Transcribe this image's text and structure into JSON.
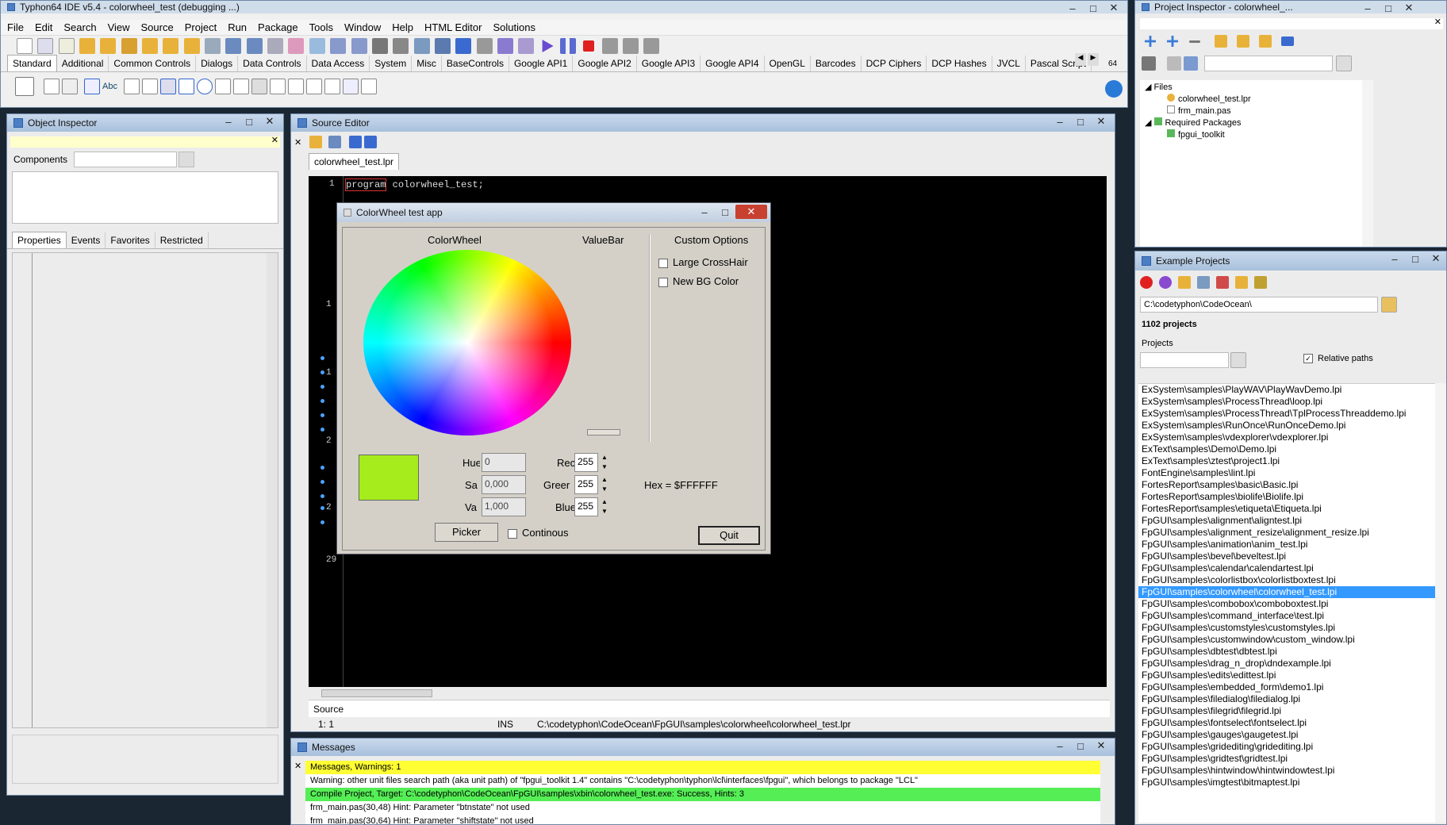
{
  "ide": {
    "title": "Typhon64 IDE v5.4 - colorwheel_test (debugging ...)",
    "menu": [
      "File",
      "Edit",
      "Search",
      "View",
      "Source",
      "Project",
      "Run",
      "Package",
      "Tools",
      "Window",
      "Help",
      "HTML Editor",
      "Solutions"
    ],
    "palette_tabs": [
      "Standard",
      "Additional",
      "Common Controls",
      "Dialogs",
      "Data Controls",
      "Data Access",
      "System",
      "Misc",
      "BaseControls",
      "Google API1",
      "Google API2",
      "Google API3",
      "Google API4",
      "OpenGL",
      "Barcodes",
      "DCP Ciphers",
      "DCP Hashes",
      "JVCL",
      "Pascal Script"
    ],
    "bits": "64"
  },
  "object_inspector": {
    "title": "Object Inspector",
    "components_label": "Components",
    "tabs": [
      "Properties",
      "Events",
      "Favorites",
      "Restricted"
    ]
  },
  "source_editor": {
    "title": "Source Editor",
    "file_tab": "colorwheel_test.lpr",
    "code_keyword": "program",
    "code_rest": " colorwheel_test;",
    "line_numbers": [
      "1",
      "1",
      "1",
      "2",
      "2",
      "29"
    ],
    "bottom_tab": "Source",
    "status_pos": "1:  1",
    "status_mode": "INS",
    "status_path": "C:\\codetyphon\\CodeOcean\\FpGUI\\samples\\colorwheel\\colorwheel_test.lpr"
  },
  "app": {
    "title": "ColorWheel test app",
    "colorwheel_label": "ColorWheel",
    "valuebar_label": "ValueBar",
    "custom_options_label": "Custom Options",
    "large_crosshair": "Large CrossHair",
    "new_bg_color": "New BG Color",
    "swatch_color": "#a6ec1c",
    "hue_label": "Hue",
    "hue_value": "0",
    "sat_label": "Sa",
    "sat_value": "0,000",
    "val_label": "Va",
    "val_value": "1,000",
    "red_label": "Rec",
    "red_value": "255",
    "green_label": "Greer",
    "green_value": "255",
    "blue_label": "Blue",
    "blue_value": "255",
    "hex": "Hex = $FFFFFF",
    "picker": "Picker",
    "continous": "Continous",
    "quit": "Quit"
  },
  "messages": {
    "title": "Messages",
    "rows": [
      {
        "text": "Messages, Warnings: 1",
        "color": "#ffff33"
      },
      {
        "text": "Warning: other unit files search path (aka unit path) of \"fpgui_toolkit 1.4\" contains \"C:\\codetyphon\\typhon\\lcl\\interfaces\\fpgui\", which belongs to package \"LCL\"",
        "color": "#ffffff"
      },
      {
        "text": "Compile Project, Target: C:\\codetyphon\\CodeOcean\\FpGUI\\samples\\xbin\\colorwheel_test.exe: Success, Hints: 3",
        "color": "#55ee55"
      },
      {
        "text": "frm_main.pas(30,48) Hint: Parameter \"btnstate\" not used",
        "color": "#ffffff"
      },
      {
        "text": "frm_main.pas(30,64) Hint: Parameter \"shiftstate\" not used",
        "color": "#ffffff"
      }
    ]
  },
  "project_inspector": {
    "title": "Project Inspector - colorwheel_...",
    "files_label": "Files",
    "files": [
      "colorwheel_test.lpr",
      "frm_main.pas"
    ],
    "required_label": "Required Packages",
    "packages": [
      "fpgui_toolkit"
    ]
  },
  "examples": {
    "title": "Example Projects",
    "path": "C:\\codetyphon\\CodeOcean\\",
    "count": "1102 projects",
    "projects_label": "Projects",
    "relative_paths": "Relative paths",
    "selected_index": 17,
    "items": [
      "ExSystem\\samples\\PlayWAV\\PlayWavDemo.lpi",
      "ExSystem\\samples\\ProcessThread\\loop.lpi",
      "ExSystem\\samples\\ProcessThread\\TplProcessThreaddemo.lpi",
      "ExSystem\\samples\\RunOnce\\RunOnceDemo.lpi",
      "ExSystem\\samples\\vdexplorer\\vdexplorer.lpi",
      "ExText\\samples\\Demo\\Demo.lpi",
      "ExText\\samples\\ztest\\project1.lpi",
      "FontEngine\\samples\\lint.lpi",
      "FortesReport\\samples\\basic\\Basic.lpi",
      "FortesReport\\samples\\biolife\\Biolife.lpi",
      "FortesReport\\samples\\etiqueta\\Etiqueta.lpi",
      "FpGUI\\samples\\alignment\\aligntest.lpi",
      "FpGUI\\samples\\alignment_resize\\alignment_resize.lpi",
      "FpGUI\\samples\\animation\\anim_test.lpi",
      "FpGUI\\samples\\bevel\\beveltest.lpi",
      "FpGUI\\samples\\calendar\\calendartest.lpi",
      "FpGUI\\samples\\colorlistbox\\colorlistboxtest.lpi",
      "FpGUI\\samples\\colorwheel\\colorwheel_test.lpi",
      "FpGUI\\samples\\combobox\\comboboxtest.lpi",
      "FpGUI\\samples\\command_interface\\test.lpi",
      "FpGUI\\samples\\customstyles\\customstyles.lpi",
      "FpGUI\\samples\\customwindow\\custom_window.lpi",
      "FpGUI\\samples\\dbtest\\dbtest.lpi",
      "FpGUI\\samples\\drag_n_drop\\dndexample.lpi",
      "FpGUI\\samples\\edits\\edittest.lpi",
      "FpGUI\\samples\\embedded_form\\demo1.lpi",
      "FpGUI\\samples\\filedialog\\filedialog.lpi",
      "FpGUI\\samples\\filegrid\\filegrid.lpi",
      "FpGUI\\samples\\fontselect\\fontselect.lpi",
      "FpGUI\\samples\\gauges\\gaugetest.lpi",
      "FpGUI\\samples\\gridediting\\gridediting.lpi",
      "FpGUI\\samples\\gridtest\\gridtest.lpi",
      "FpGUI\\samples\\hintwindow\\hintwindowtest.lpi",
      "FpGUI\\samples\\imgtest\\bitmaptest.lpi"
    ]
  }
}
